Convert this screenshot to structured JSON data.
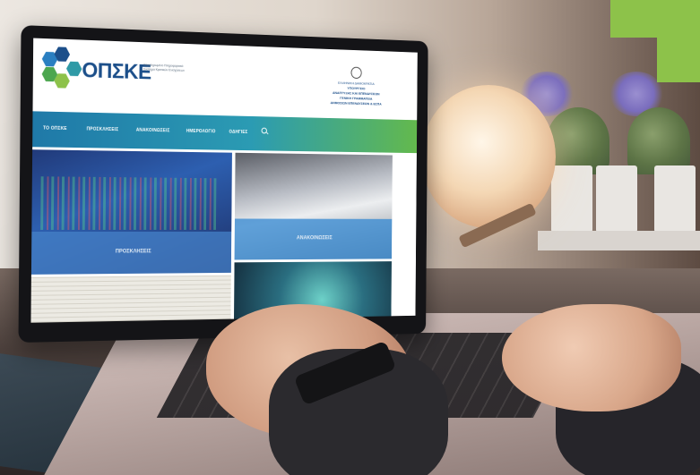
{
  "site": {
    "logo_text": "ΟΠΣΚΕ",
    "logo_subtitle": "Ολοκληρωμένο Πληροφοριακό Σύστημα Κρατικών Ενισχύσεων",
    "government_lines": [
      "ΕΛΛΗΝΙΚΗ ΔΗΜΟΚΡΑΤΙΑ",
      "ΥΠΟΥΡΓΕΙΟ",
      "ΑΝΑΠΤΥΞΗΣ ΚΑΙ ΕΠΕΝΔΥΣΕΩΝ",
      "ΓΕΝΙΚΗ ΓΡΑΜΜΑΤΕΙΑ",
      "ΔΗΜΟΣΙΩΝ ΕΠΕΝΔΥΣΕΩΝ & ΕΣΠΑ"
    ],
    "nav": [
      "ΤΟ ΟΠΣΚΕ",
      "ΠΡΟΣΚΛΗΣΕΙΣ",
      "ΑΝΑΚΟΙΝΩΣΕΙΣ",
      "ΗΜΕΡΟΛΟΓΙΟ",
      "ΟΔΗΓΙΕΣ"
    ],
    "tiles": [
      "ΠΡΟΣΚΛΗΣΕΙΣ",
      "ΑΝΑΚΟΙΝΩΣΕΙΣ"
    ]
  },
  "colors": {
    "corner_accent": "#8dc24a",
    "logo_blue": "#1c4f8a",
    "nav_start": "#1f79a8",
    "nav_end": "#63b94d"
  },
  "icons": [
    "search-icon"
  ]
}
